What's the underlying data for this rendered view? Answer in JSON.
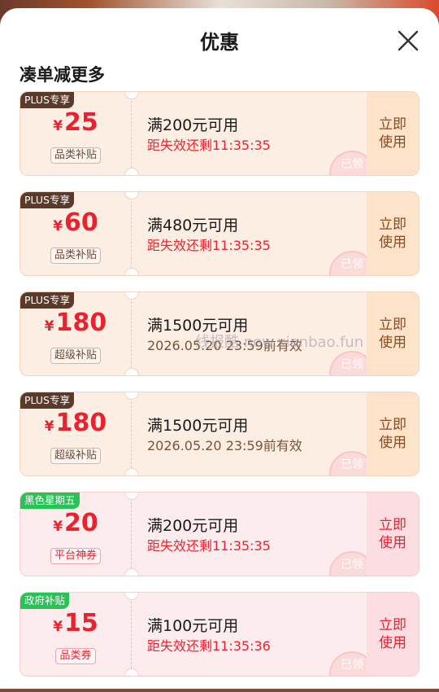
{
  "header": {
    "title": "优惠"
  },
  "section": {
    "title": "凑单减更多"
  },
  "coupons": [
    {
      "theme": "plus",
      "tag": "PLUS专享",
      "yen": "¥",
      "amount": "25",
      "kind": "品类补贴",
      "condition": "满200元可用",
      "expire": "距失效还剩11:35:35",
      "expire_style": "red",
      "stamp": "已领",
      "action": "立即使用"
    },
    {
      "theme": "plus",
      "tag": "PLUS专享",
      "yen": "¥",
      "amount": "60",
      "kind": "品类补贴",
      "condition": "满480元可用",
      "expire": "距失效还剩11:35:35",
      "expire_style": "red",
      "stamp": "已领",
      "action": "立即使用"
    },
    {
      "theme": "plus",
      "tag": "PLUS专享",
      "yen": "¥",
      "amount": "180",
      "kind": "超级补贴",
      "condition": "满1500元可用",
      "expire": "2026.05.20 23:59前有效",
      "expire_style": "brown",
      "stamp": "已领",
      "action": "立即使用"
    },
    {
      "theme": "plus",
      "tag": "PLUS专享",
      "yen": "¥",
      "amount": "180",
      "kind": "超级补贴",
      "condition": "满1500元可用",
      "expire": "2026.05.20 23:59前有效",
      "expire_style": "brown",
      "stamp": "已领",
      "action": "立即使用"
    },
    {
      "theme": "red",
      "tag": "黑色星期五",
      "yen": "¥",
      "amount": "20",
      "kind": "平台神券",
      "condition": "满200元可用",
      "expire": "距失效还剩11:35:35",
      "expire_style": "red",
      "stamp": "已领",
      "action": "立即使用"
    },
    {
      "theme": "red",
      "tag": "政府补贴",
      "yen": "¥",
      "amount": "15",
      "kind": "品类券",
      "condition": "满100元可用",
      "expire": "距失效还剩11:35:36",
      "expire_style": "red",
      "stamp": "已领",
      "action": "立即使用"
    }
  ],
  "watermark": "线报酷 new.xianbao.fun",
  "colors": {
    "accent_red": "#e8232f",
    "plus_tag": "#5a3a2a",
    "green_tag": "#25c455"
  },
  "icons": {
    "close": "close-icon"
  }
}
